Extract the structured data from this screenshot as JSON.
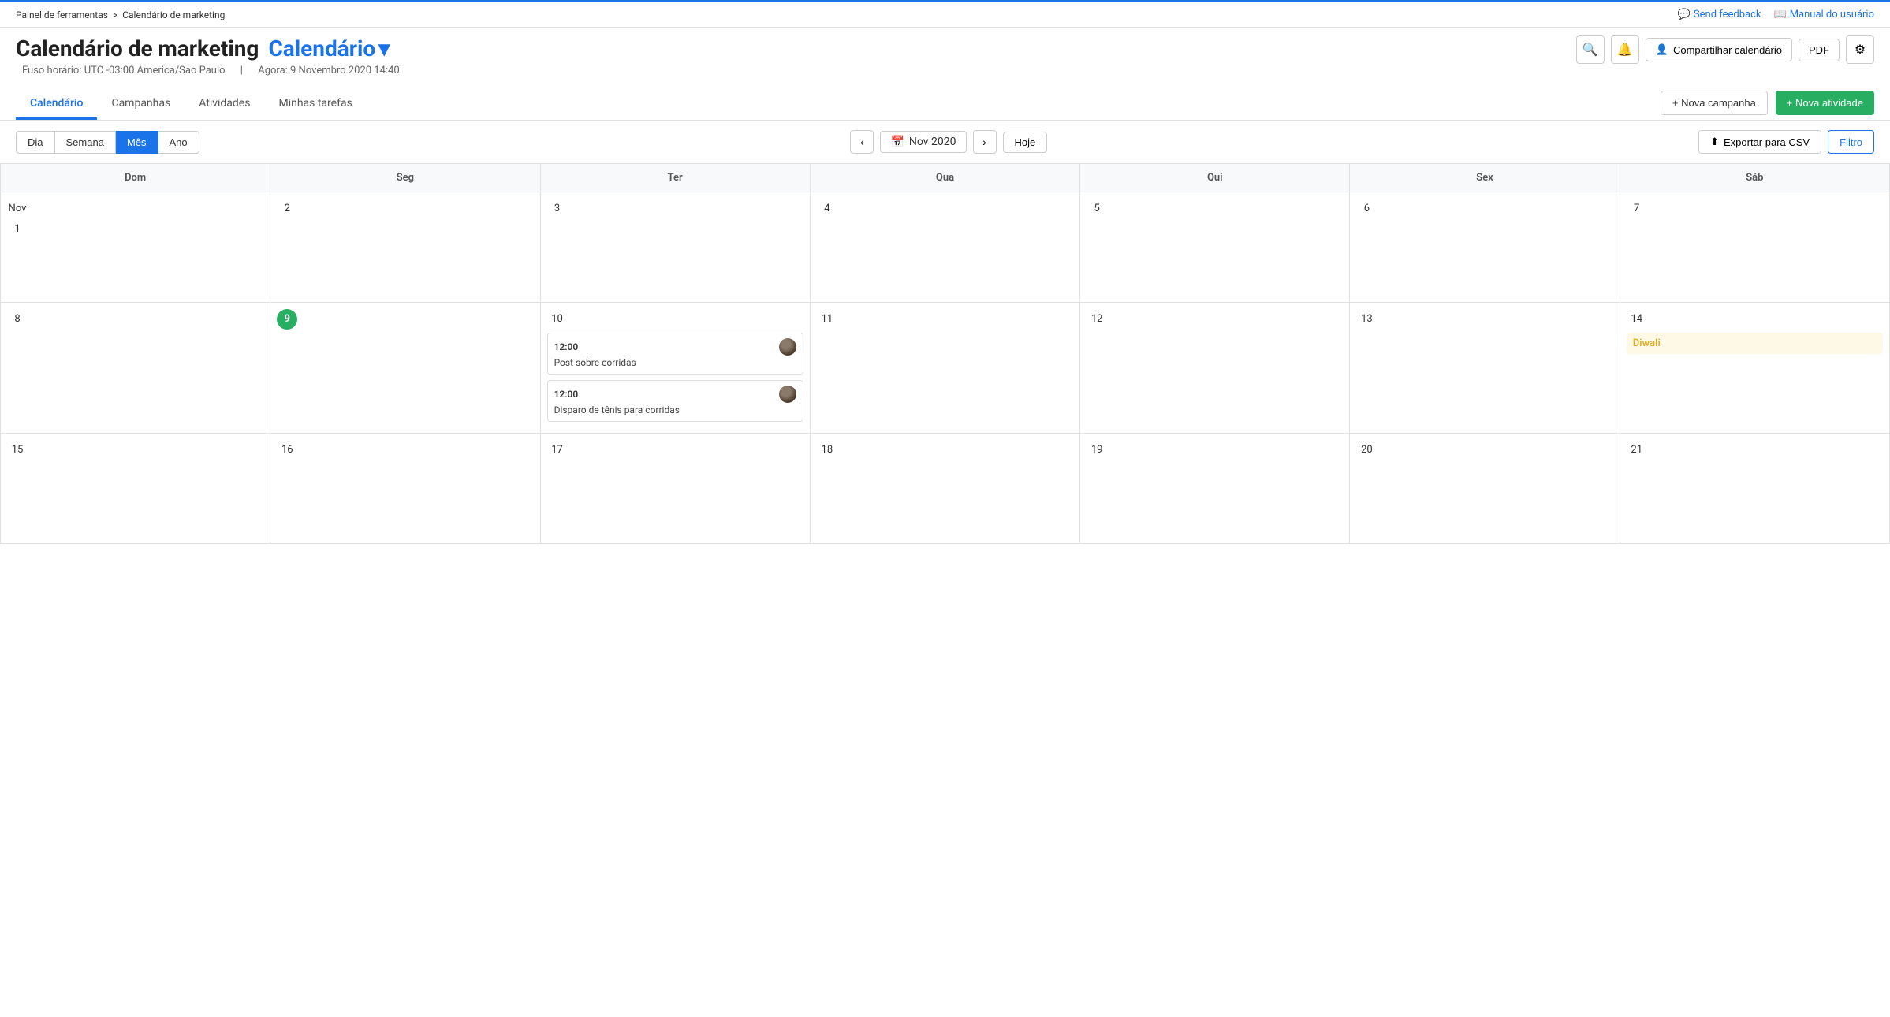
{
  "topAccent": true,
  "topBar": {
    "breadcrumb": {
      "parent": "Painel de ferramentas",
      "separator": ">",
      "current": "Calendário de marketing"
    },
    "actions": {
      "feedback": "Send feedback",
      "manual": "Manual do usuário"
    }
  },
  "header": {
    "title": "Calendário de marketing",
    "titleBlue": "Calendário",
    "dropdownIcon": "▾",
    "timezone": "Fuso horário: UTC -03:00 America/Sao Paulo",
    "separator": "|",
    "now": "Agora: 9 Novembro 2020 14:40"
  },
  "headerButtons": {
    "search": "🔍",
    "bell": "🔔",
    "share": "Compartilhar calendário",
    "pdf": "PDF",
    "settings": "⚙"
  },
  "tabs": {
    "items": [
      {
        "label": "Calendário",
        "active": true
      },
      {
        "label": "Campanhas",
        "active": false
      },
      {
        "label": "Atividades",
        "active": false
      },
      {
        "label": "Minhas tarefas",
        "active": false
      }
    ],
    "newCampaign": "+ Nova campanha",
    "newActivity": "+ Nova atividade"
  },
  "toolbar": {
    "views": [
      {
        "label": "Dia",
        "active": false
      },
      {
        "label": "Semana",
        "active": false
      },
      {
        "label": "Mês",
        "active": true
      },
      {
        "label": "Ano",
        "active": false
      }
    ],
    "prevIcon": "‹",
    "calIcon": "📅",
    "month": "Nov 2020",
    "nextIcon": "›",
    "today": "Hoje",
    "export": "Exportar para CSV",
    "filter": "Filtro"
  },
  "calendar": {
    "headers": [
      "Dom",
      "Seg",
      "Ter",
      "Qua",
      "Qui",
      "Sex",
      "Sáb"
    ],
    "weeks": [
      [
        {
          "day": "Nov 1",
          "num": "Nov 1",
          "events": []
        },
        {
          "day": "2",
          "num": "2",
          "events": []
        },
        {
          "day": "3",
          "num": "3",
          "events": []
        },
        {
          "day": "4",
          "num": "4",
          "events": []
        },
        {
          "day": "5",
          "num": "5",
          "events": []
        },
        {
          "day": "6",
          "num": "6",
          "events": []
        },
        {
          "day": "7",
          "num": "7",
          "events": []
        }
      ],
      [
        {
          "day": "8",
          "num": "8",
          "events": []
        },
        {
          "day": "9",
          "num": "9",
          "today": true,
          "events": []
        },
        {
          "day": "10",
          "num": "10",
          "events": [
            {
              "time": "12:00",
              "title": "Post sobre corridas",
              "hasAvatar": true
            },
            {
              "time": "12:00",
              "title": "Disparo de tênis para corridas",
              "hasAvatar": true
            }
          ]
        },
        {
          "day": "11",
          "num": "11",
          "events": []
        },
        {
          "day": "12",
          "num": "12",
          "events": []
        },
        {
          "day": "13",
          "num": "13",
          "events": []
        },
        {
          "day": "14",
          "num": "14",
          "events": [
            {
              "type": "holiday",
              "title": "Diwali"
            }
          ]
        }
      ],
      [
        {
          "day": "15",
          "num": "15",
          "events": []
        },
        {
          "day": "16",
          "num": "16",
          "events": []
        },
        {
          "day": "17",
          "num": "17",
          "events": []
        },
        {
          "day": "18",
          "num": "18",
          "events": []
        },
        {
          "day": "19",
          "num": "19",
          "events": []
        },
        {
          "day": "20",
          "num": "20",
          "events": []
        },
        {
          "day": "21",
          "num": "21",
          "events": []
        }
      ]
    ]
  }
}
